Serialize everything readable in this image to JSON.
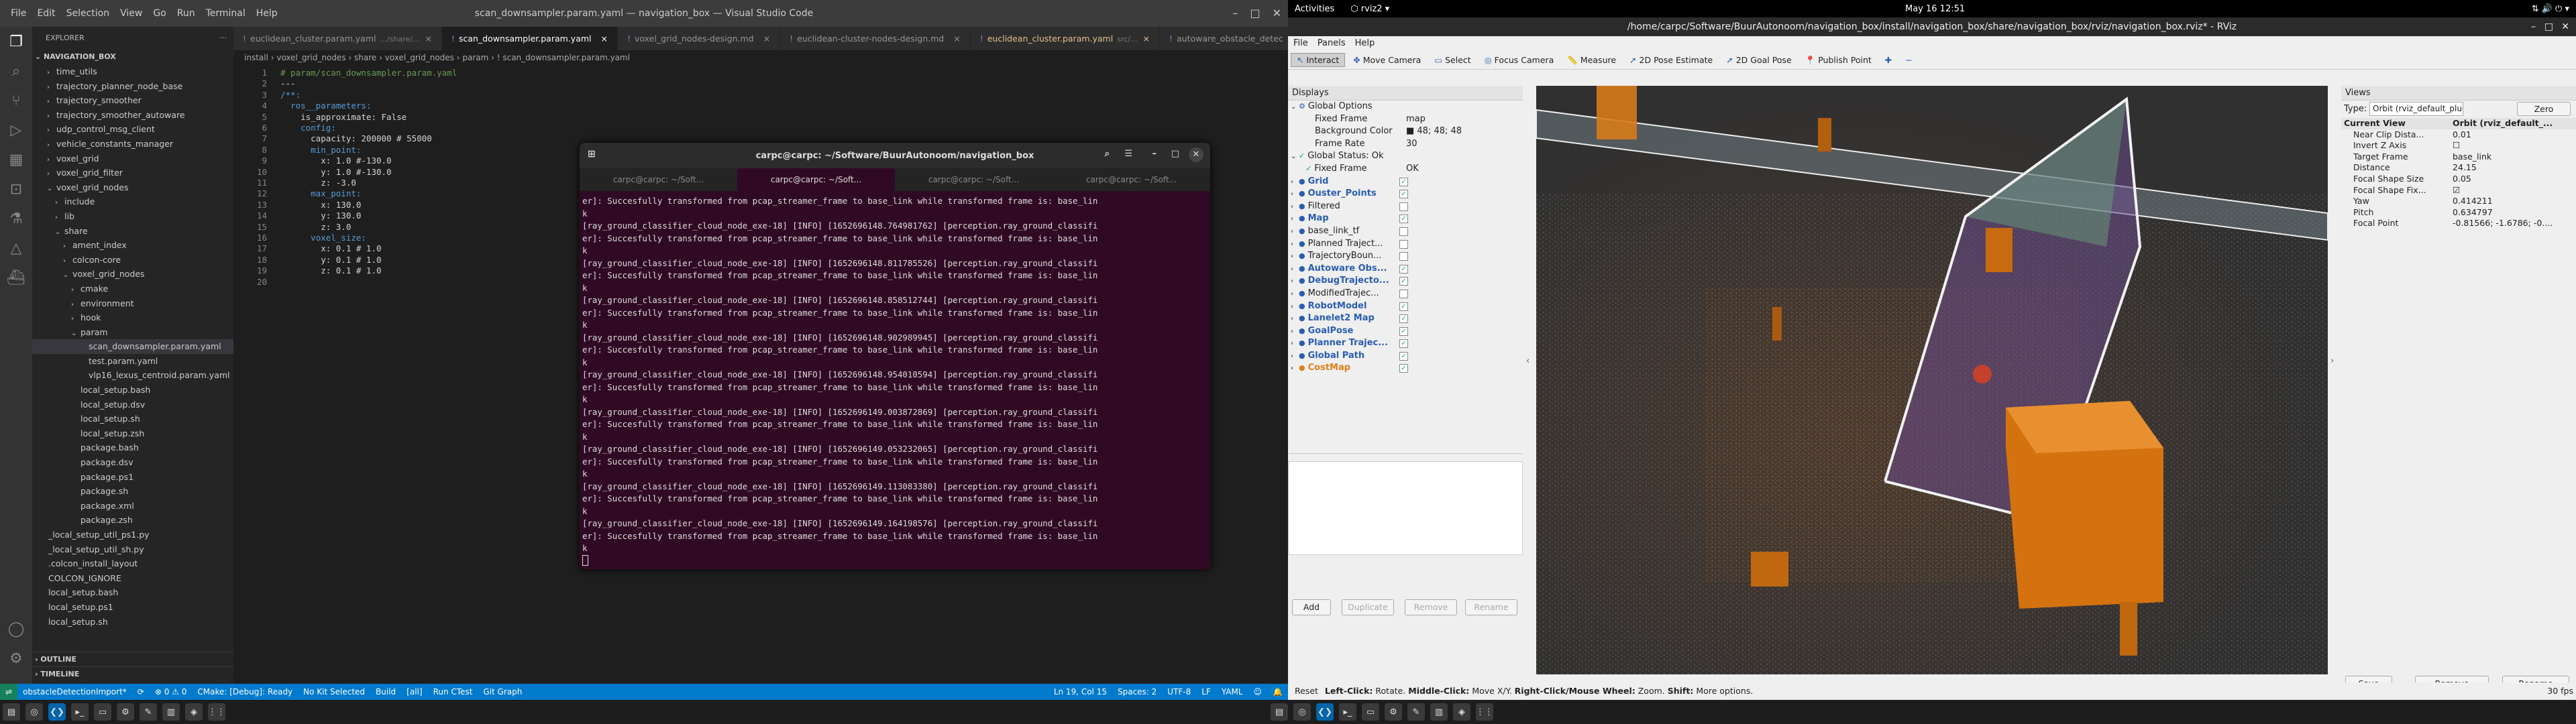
{
  "vscode": {
    "window_title": "scan_downsampler.param.yaml — navigation_box — Visual Studio Code",
    "menu": [
      "File",
      "Edit",
      "Selection",
      "View",
      "Go",
      "Run",
      "Terminal",
      "Help"
    ],
    "explorer": {
      "title": "EXPLORER",
      "root": "NAVIGATION_BOX",
      "items": [
        {
          "label": "time_utils",
          "indent": 1,
          "chev": "›",
          "cls": ""
        },
        {
          "label": "trajectory_planner_node_base",
          "indent": 1,
          "chev": "›",
          "cls": ""
        },
        {
          "label": "trajectory_smoother",
          "indent": 1,
          "chev": "›",
          "cls": ""
        },
        {
          "label": "trajectory_smoother_autoware",
          "indent": 1,
          "chev": "›",
          "cls": ""
        },
        {
          "label": "udp_control_msg_client",
          "indent": 1,
          "chev": "›",
          "cls": ""
        },
        {
          "label": "vehicle_constants_manager",
          "indent": 1,
          "chev": "›",
          "cls": ""
        },
        {
          "label": "voxel_grid",
          "indent": 1,
          "chev": "›",
          "cls": ""
        },
        {
          "label": "voxel_grid_filter",
          "indent": 1,
          "chev": "›",
          "cls": ""
        },
        {
          "label": "voxel_grid_nodes",
          "indent": 1,
          "chev": "⌄",
          "cls": ""
        },
        {
          "label": "include",
          "indent": 2,
          "chev": "›",
          "cls": ""
        },
        {
          "label": "lib",
          "indent": 2,
          "chev": "›",
          "cls": ""
        },
        {
          "label": "share",
          "indent": 2,
          "chev": "⌄",
          "cls": ""
        },
        {
          "label": "ament_index",
          "indent": 3,
          "chev": "›",
          "cls": ""
        },
        {
          "label": "colcon-core",
          "indent": 3,
          "chev": "›",
          "cls": ""
        },
        {
          "label": "voxel_grid_nodes",
          "indent": 3,
          "chev": "⌄",
          "cls": ""
        },
        {
          "label": "cmake",
          "indent": 4,
          "chev": "›",
          "cls": ""
        },
        {
          "label": "environment",
          "indent": 4,
          "chev": "›",
          "cls": ""
        },
        {
          "label": "hook",
          "indent": 4,
          "chev": "›",
          "cls": ""
        },
        {
          "label": "param",
          "indent": 4,
          "chev": "⌄",
          "cls": ""
        },
        {
          "label": "scan_downsampler.param.yaml",
          "indent": 5,
          "chev": "",
          "cls": "sel"
        },
        {
          "label": "test.param.yaml",
          "indent": 5,
          "chev": "",
          "cls": ""
        },
        {
          "label": "vlp16_lexus_centroid.param.yaml",
          "indent": 5,
          "chev": "",
          "cls": ""
        },
        {
          "label": "local_setup.bash",
          "indent": 4,
          "chev": "",
          "cls": ""
        },
        {
          "label": "local_setup.dsv",
          "indent": 4,
          "chev": "",
          "cls": ""
        },
        {
          "label": "local_setup.sh",
          "indent": 4,
          "chev": "",
          "cls": ""
        },
        {
          "label": "local_setup.zsh",
          "indent": 4,
          "chev": "",
          "cls": ""
        },
        {
          "label": "package.bash",
          "indent": 4,
          "chev": "",
          "cls": ""
        },
        {
          "label": "package.dsv",
          "indent": 4,
          "chev": "",
          "cls": ""
        },
        {
          "label": "package.ps1",
          "indent": 4,
          "chev": "",
          "cls": ""
        },
        {
          "label": "package.sh",
          "indent": 4,
          "chev": "",
          "cls": ""
        },
        {
          "label": "package.xml",
          "indent": 4,
          "chev": "",
          "cls": ""
        },
        {
          "label": "package.zsh",
          "indent": 4,
          "chev": "",
          "cls": ""
        },
        {
          "label": "_local_setup_util_ps1.py",
          "indent": 0,
          "chev": "",
          "cls": ""
        },
        {
          "label": "_local_setup_util_sh.py",
          "indent": 0,
          "chev": "",
          "cls": ""
        },
        {
          "label": ".colcon_install_layout",
          "indent": 0,
          "chev": "",
          "cls": ""
        },
        {
          "label": "COLCON_IGNORE",
          "indent": 0,
          "chev": "",
          "cls": ""
        },
        {
          "label": "local_setup.bash",
          "indent": 0,
          "chev": "",
          "cls": ""
        },
        {
          "label": "local_setup.ps1",
          "indent": 0,
          "chev": "",
          "cls": ""
        },
        {
          "label": "local_setup.sh",
          "indent": 0,
          "chev": "",
          "cls": ""
        }
      ],
      "outline": "OUTLINE",
      "timeline": "TIMELINE"
    },
    "tabs": [
      {
        "label": "euclidean_cluster.param.yaml",
        "hint": ".../share/...",
        "cls": ""
      },
      {
        "label": "scan_downsampler.param.yaml",
        "hint": "",
        "cls": "act"
      },
      {
        "label": "voxel_grid_nodes-design.md",
        "hint": "",
        "cls": ""
      },
      {
        "label": "euclidean-cluster-nodes-design.md",
        "hint": "",
        "cls": ""
      },
      {
        "label": "euclidean_cluster.param.yaml",
        "hint": "src/...",
        "cls": "mod"
      },
      {
        "label": "autoware_obstacle_detec",
        "hint": "",
        "cls": ""
      }
    ],
    "breadcrumb": "install › voxel_grid_nodes › share › voxel_grid_nodes › param › ! scan_downsampler.param.yaml",
    "code_lines": [
      "# param/scan_downsampler.param.yaml",
      "---",
      "/**:",
      "  ros__parameters:",
      "    is_approximate: False",
      "    config:",
      "      capacity: 200000 # 55000",
      "      min_point:",
      "        x: 1.0 #-130.0",
      "        y: 1.0 #-130.0",
      "        z: -3.0",
      "      max_point:",
      "        x: 130.0",
      "        y: 130.0",
      "        z: 3.0",
      "      voxel_size:",
      "        x: 0.1 # 1.0",
      "        y: 0.1 # 1.0",
      "        z: 0.1 # 1.0",
      ""
    ],
    "terminal": {
      "title": "carpc@carpc: ~/Software/BuurAutonoom/navigation_box",
      "tabs": [
        "carpc@carpc: ~/Soft...",
        "carpc@carpc: ~/Soft...",
        "carpc@carpc: ~/Soft...",
        "carpc@carpc: ~/Soft..."
      ],
      "lines": [
        "er]: Succesfully transformed from pcap_streamer_frame to base_link while transformed frame is: base_lin",
        "k",
        "[ray_ground_classifier_cloud_node_exe-18] [INFO] [1652696148.764981762] [perception.ray_ground_classifi",
        "er]: Succesfully transformed from pcap_streamer_frame to base_link while transformed frame is: base_lin",
        "k",
        "[ray_ground_classifier_cloud_node_exe-18] [INFO] [1652696148.811785526] [perception.ray_ground_classifi",
        "er]: Succesfully transformed from pcap_streamer_frame to base_link while transformed frame is: base_lin",
        "k",
        "[ray_ground_classifier_cloud_node_exe-18] [INFO] [1652696148.858512744] [perception.ray_ground_classifi",
        "er]: Succesfully transformed from pcap_streamer_frame to base_link while transformed frame is: base_lin",
        "k",
        "[ray_ground_classifier_cloud_node_exe-18] [INFO] [1652696148.902989945] [perception.ray_ground_classifi",
        "er]: Succesfully transformed from pcap_streamer_frame to base_link while transformed frame is: base_lin",
        "k",
        "[ray_ground_classifier_cloud_node_exe-18] [INFO] [1652696148.954010594] [perception.ray_ground_classifi",
        "er]: Succesfully transformed from pcap_streamer_frame to base_link while transformed frame is: base_lin",
        "k",
        "[ray_ground_classifier_cloud_node_exe-18] [INFO] [1652696149.003872869] [perception.ray_ground_classifi",
        "er]: Succesfully transformed from pcap_streamer_frame to base_link while transformed frame is: base_lin",
        "k",
        "[ray_ground_classifier_cloud_node_exe-18] [INFO] [1652696149.053232065] [perception.ray_ground_classifi",
        "er]: Succesfully transformed from pcap_streamer_frame to base_link while transformed frame is: base_lin",
        "k",
        "[ray_ground_classifier_cloud_node_exe-18] [INFO] [1652696149.113083380] [perception.ray_ground_classifi",
        "er]: Succesfully transformed from pcap_streamer_frame to base_link while transformed frame is: base_lin",
        "k",
        "[ray_ground_classifier_cloud_node_exe-18] [INFO] [1652696149.164198576] [perception.ray_ground_classifi",
        "er]: Succesfully transformed from pcap_streamer_frame to base_link while transformed frame is: base_lin",
        "k"
      ]
    },
    "status": {
      "branch": "obstacleDetectionImport*",
      "sync": "⟳",
      "errors": "⊗ 0 ⚠ 0",
      "cmake": "CMake: [Debug]: Ready",
      "kit": "No Kit Selected",
      "build": "Build",
      "all": "[all]",
      "run": "Run CTest",
      "git": "Git Graph",
      "pos": "Ln 19, Col 15",
      "spaces": "Spaces: 2",
      "enc": "UTF-8",
      "eol": "LF",
      "lang": "YAML"
    }
  },
  "ubuntu": {
    "activities": "Activities",
    "app": "rviz2",
    "clock": "May 16  12:51"
  },
  "rviz": {
    "title": "/home/carpc/Software/BuurAutonoom/navigation_box/install/navigation_box/share/navigation_box/rviz/navigation_box.rviz* - RViz",
    "menu": [
      "File",
      "Panels",
      "Help"
    ],
    "tools": [
      {
        "label": "Interact",
        "cls": "on"
      },
      {
        "label": "Move Camera",
        "cls": ""
      },
      {
        "label": "Select",
        "cls": ""
      },
      {
        "label": "Focus Camera",
        "cls": ""
      },
      {
        "label": "Measure",
        "cls": ""
      },
      {
        "label": "2D Pose Estimate",
        "cls": ""
      },
      {
        "label": "2D Goal Pose",
        "cls": ""
      },
      {
        "label": "Publish Point",
        "cls": ""
      }
    ],
    "displays_title": "Displays",
    "displays": [
      {
        "label": "Global Options",
        "indent": 0,
        "chev": "⌄",
        "val": "",
        "chk": "",
        "cls": "",
        "icon": "⚙"
      },
      {
        "label": "Fixed Frame",
        "indent": 2,
        "chev": "",
        "val": "map",
        "chk": "",
        "cls": "",
        "icon": ""
      },
      {
        "label": "Background Color",
        "indent": 2,
        "chev": "",
        "val": "■ 48; 48; 48",
        "chk": "",
        "cls": "",
        "icon": ""
      },
      {
        "label": "Frame Rate",
        "indent": 2,
        "chev": "",
        "val": "30",
        "chk": "",
        "cls": "",
        "icon": ""
      },
      {
        "label": "Global Status: Ok",
        "indent": 0,
        "chev": "⌄",
        "val": "",
        "chk": "",
        "cls": "",
        "icon": "✓"
      },
      {
        "label": "Fixed Frame",
        "indent": 1,
        "chev": "",
        "val": "OK",
        "chk": "",
        "cls": "",
        "icon": "✓"
      },
      {
        "label": "Grid",
        "indent": 0,
        "chev": "›",
        "val": "",
        "chk": "✓",
        "cls": "blue",
        "icon": "●"
      },
      {
        "label": "Ouster_Points",
        "indent": 0,
        "chev": "›",
        "val": "",
        "chk": "✓",
        "cls": "blue",
        "icon": "●"
      },
      {
        "label": "Filtered",
        "indent": 0,
        "chev": "›",
        "val": "",
        "chk": "",
        "cls": "",
        "icon": "●"
      },
      {
        "label": "Map",
        "indent": 0,
        "chev": "›",
        "val": "",
        "chk": "✓",
        "cls": "blue",
        "icon": "●"
      },
      {
        "label": "base_link_tf",
        "indent": 0,
        "chev": "›",
        "val": "",
        "chk": "",
        "cls": "",
        "icon": "●"
      },
      {
        "label": "Planned Traject...",
        "indent": 0,
        "chev": "›",
        "val": "",
        "chk": "",
        "cls": "",
        "icon": "●"
      },
      {
        "label": "TrajectoryBoun...",
        "indent": 0,
        "chev": "›",
        "val": "",
        "chk": "",
        "cls": "",
        "icon": "●"
      },
      {
        "label": "Autoware Obs...",
        "indent": 0,
        "chev": "›",
        "val": "",
        "chk": "✓",
        "cls": "blue",
        "icon": "●"
      },
      {
        "label": "DebugTrajecto...",
        "indent": 0,
        "chev": "›",
        "val": "",
        "chk": "✓",
        "cls": "blue",
        "icon": "●"
      },
      {
        "label": "ModifiedTrajec...",
        "indent": 0,
        "chev": "›",
        "val": "",
        "chk": "",
        "cls": "",
        "icon": "●"
      },
      {
        "label": "RobotModel",
        "indent": 0,
        "chev": "›",
        "val": "",
        "chk": "✓",
        "cls": "blue",
        "icon": "●"
      },
      {
        "label": "Lanelet2 Map",
        "indent": 0,
        "chev": "›",
        "val": "",
        "chk": "✓",
        "cls": "blue",
        "icon": "●"
      },
      {
        "label": "GoalPose",
        "indent": 0,
        "chev": "›",
        "val": "",
        "chk": "✓",
        "cls": "blue",
        "icon": "●"
      },
      {
        "label": "Planner Trajec...",
        "indent": 0,
        "chev": "›",
        "val": "",
        "chk": "✓",
        "cls": "blue",
        "icon": "●"
      },
      {
        "label": "Global Path",
        "indent": 0,
        "chev": "›",
        "val": "",
        "chk": "✓",
        "cls": "blue",
        "icon": "●"
      },
      {
        "label": "CostMap",
        "indent": 0,
        "chev": "›",
        "val": "",
        "chk": "✓",
        "cls": "orange",
        "icon": "●"
      }
    ],
    "disp_buttons": {
      "add": "Add",
      "duplicate": "Duplicate",
      "remove": "Remove",
      "rename": "Rename"
    },
    "views": {
      "title": "Views",
      "type_label": "Type:",
      "type_value": "Orbit (rviz_default_plugins)",
      "zero": "Zero",
      "rows": [
        {
          "k": "Current View",
          "v": "Orbit (rviz_default_...",
          "bold": true,
          "indent": 0
        },
        {
          "k": "Near Clip Dista...",
          "v": "0.01",
          "bold": false,
          "indent": 1
        },
        {
          "k": "Invert Z Axis",
          "v": "☐",
          "bold": false,
          "indent": 1
        },
        {
          "k": "Target Frame",
          "v": "base_link",
          "bold": false,
          "indent": 1
        },
        {
          "k": "Distance",
          "v": "24.15",
          "bold": false,
          "indent": 1
        },
        {
          "k": "Focal Shape Size",
          "v": "0.05",
          "bold": false,
          "indent": 1
        },
        {
          "k": "Focal Shape Fix...",
          "v": "☑",
          "bold": false,
          "indent": 1
        },
        {
          "k": "Yaw",
          "v": "0.414211",
          "bold": false,
          "indent": 1
        },
        {
          "k": "Pitch",
          "v": "0.634797",
          "bold": false,
          "indent": 1
        },
        {
          "k": "Focal Point",
          "v": "-0.81566; -1.6786; -0....",
          "bold": false,
          "indent": 1
        }
      ],
      "save": "Save",
      "remove": "Remove",
      "rename": "Rename"
    },
    "status": {
      "reset": "Reset",
      "hint_lc": "Left-Click:",
      "hint_lc_v": "Rotate.",
      "hint_mc": "Middle-Click:",
      "hint_mc_v": "Move X/Y.",
      "hint_rc": "Right-Click/Mouse Wheel:",
      "hint_rc_v": "Zoom.",
      "hint_sh": "Shift:",
      "hint_sh_v": "More options.",
      "fps": "30 fps"
    }
  }
}
